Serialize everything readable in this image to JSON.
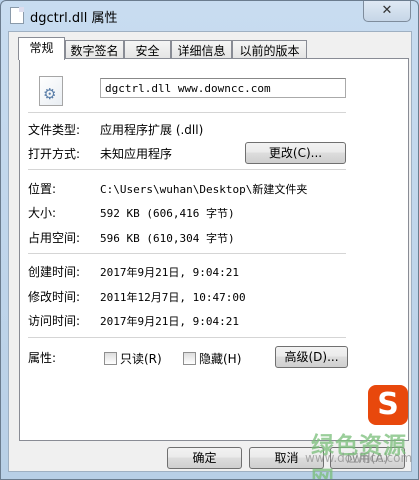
{
  "window": {
    "title": "dgctrl.dll 属性",
    "close_glyph": "✕"
  },
  "tabs": [
    {
      "label": "常规",
      "active": true
    },
    {
      "label": "数字签名",
      "active": false
    },
    {
      "label": "安全",
      "active": false
    },
    {
      "label": "详细信息",
      "active": false
    },
    {
      "label": "以前的版本",
      "active": false
    }
  ],
  "general": {
    "file_name": "dgctrl.dll www.downcc.com",
    "file_type_label": "文件类型:",
    "file_type_value": "应用程序扩展 (.dll)",
    "open_with_label": "打开方式:",
    "open_with_value": "未知应用程序",
    "change_button": "更改(C)...",
    "location_label": "位置:",
    "location_value": "C:\\Users\\wuhan\\Desktop\\新建文件夹",
    "size_label": "大小:",
    "size_value": "592 KB (606,416 字节)",
    "size_on_disk_label": "占用空间:",
    "size_on_disk_value": "596 KB (610,304 字节)",
    "created_label": "创建时间:",
    "created_value": "2017年9月21日, 9:04:21",
    "modified_label": "修改时间:",
    "modified_value": "2011年12月7日, 10:47:00",
    "accessed_label": "访问时间:",
    "accessed_value": "2017年9月21日, 9:04:21",
    "attributes_label": "属性:",
    "readonly_label": "只读(R)",
    "hidden_label": "隐藏(H)",
    "advanced_button": "高级(D)..."
  },
  "footer": {
    "ok": "确定",
    "cancel": "取消",
    "apply": "应用(A)"
  },
  "watermark": {
    "logo_letter": "S",
    "text": "绿色资源网",
    "url": "www.downcc.com"
  },
  "icons": {
    "file": "dll-file-icon",
    "gear": "gear-icon",
    "app": "document-icon"
  }
}
